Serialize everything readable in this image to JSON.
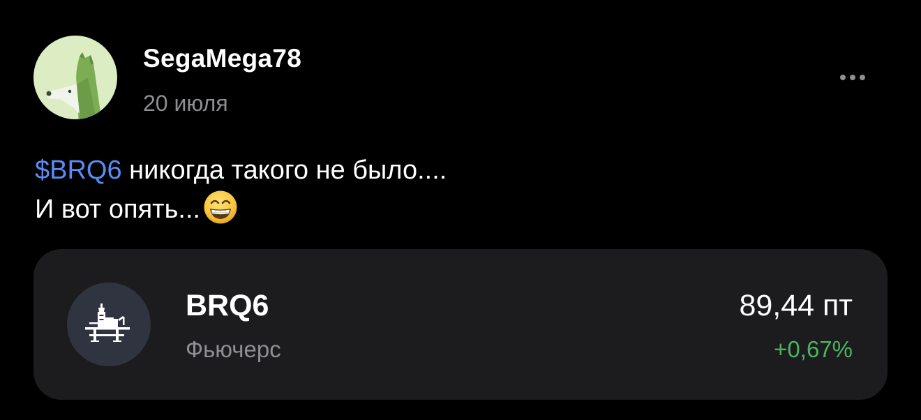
{
  "post": {
    "author": {
      "username": "SegaMega78",
      "avatar_icon": "dog-avatar-icon"
    },
    "date": "20 июля",
    "more_icon": "more-horizontal-icon",
    "text": {
      "ticker_link": "$BRQ6",
      "line1_rest": " никогда такого не было....",
      "line2": "И вот опять...",
      "emoji": "grinning-face-with-smiling-eyes-icon"
    }
  },
  "instrument": {
    "ticker": "BRQ6",
    "type": "Фьючерс",
    "price": "89,44 пт",
    "change": "+0,67%",
    "logo_icon": "oil-platform-icon"
  },
  "colors": {
    "background": "#000000",
    "card_background": "#1c1c1e",
    "link": "#5b8cf5",
    "secondary_text": "#8e8e93",
    "positive_change": "#4cb361"
  }
}
